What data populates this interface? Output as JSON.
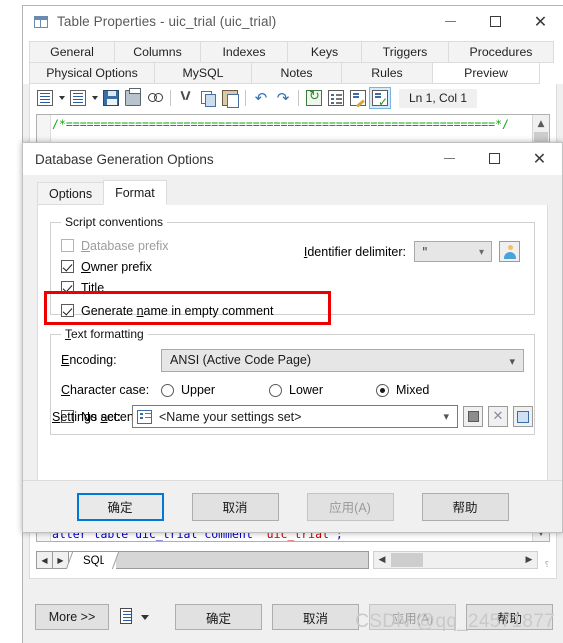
{
  "outer_window": {
    "title": "Table Properties - uic_trial (uic_trial)",
    "icon": "table-icon",
    "window_controls": {
      "minimize": "minimize-icon",
      "maximize": "maximize-icon",
      "close": "close-icon"
    },
    "tabs_row1": [
      "General",
      "Columns",
      "Indexes",
      "Keys",
      "Triggers",
      "Procedures"
    ],
    "tabs_row2": [
      "Physical Options",
      "MySQL",
      "Notes",
      "Rules",
      "Preview"
    ],
    "selected_tab": "Preview",
    "editor_toolbar": {
      "buttons": [
        "new-script-icon",
        "open-script-icon",
        "save-icon",
        "print-icon",
        "find-icon",
        "cut-icon",
        "copy-icon",
        "paste-icon",
        "undo-icon",
        "redo-icon",
        "refresh-icon",
        "outline-icon",
        "edit-icon",
        "check-syntax-icon"
      ],
      "status": "Ln 1, Col 1"
    },
    "code": {
      "line1": "/*==============================================================*/",
      "line_bottom_parts": [
        "alter table uic_trial comment ",
        "'uic_trial'",
        ";"
      ]
    },
    "sql_tab": "SQL",
    "bottom_buttons": {
      "more": "More >>",
      "ok": "确定",
      "cancel": "取消",
      "apply": "应用(A)",
      "help": "帮助"
    }
  },
  "inner_dialog": {
    "title": "Database Generation Options",
    "window_controls": {
      "minimize": "minimize-icon",
      "maximize": "maximize-icon",
      "close": "close-icon"
    },
    "tabs": [
      "Options",
      "Format"
    ],
    "selected_tab": "Format",
    "script_conventions": {
      "legend": "Script conventions",
      "checkboxes": [
        {
          "label": "Database prefix",
          "checked": false,
          "disabled": true,
          "mnemonic": "D"
        },
        {
          "label": "Owner prefix",
          "checked": true,
          "disabled": false,
          "mnemonic": "O"
        },
        {
          "label": "Title",
          "checked": true,
          "disabled": false,
          "mnemonic": "T"
        },
        {
          "label": "Generate name in empty comment",
          "checked": true,
          "disabled": false,
          "mnemonic": "n",
          "highlighted": true
        }
      ],
      "identifier_delimiter_label": "Identifier delimiter:",
      "identifier_delimiter_value": "\"",
      "user_button": "user-icon"
    },
    "text_formatting": {
      "legend": "Text formatting",
      "encoding_label": "Encoding:",
      "encoding_value": "ANSI (Active Code Page)",
      "character_case_label": "Character case:",
      "character_case_options": [
        "Upper",
        "Lower",
        "Mixed"
      ],
      "character_case_selected": "Mixed",
      "no_accent_label": "No accent",
      "no_accent_checked": false
    },
    "settings_set": {
      "label": "Settings set:",
      "value": "<Name your settings set>",
      "icon": "settings-set-icon",
      "buttons": [
        "save-set-icon",
        "delete-set-icon",
        "new-set-icon"
      ]
    },
    "bottom_buttons": {
      "ok": "确定",
      "cancel": "取消",
      "apply": "应用(A)",
      "help": "帮助"
    }
  },
  "watermark": "CSDN @qq_24571877",
  "colors": {
    "highlight": "#ee0000",
    "default_button_border": "#0078d7",
    "code_comment": "#12a012",
    "code_keyword": "#0000cd",
    "code_string": "#cc0000"
  }
}
